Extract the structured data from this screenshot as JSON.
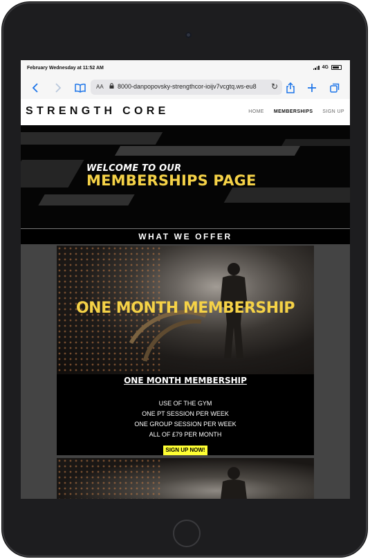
{
  "status_bar": {
    "time": "February Wednesday at 11:52 AM",
    "network": "4G"
  },
  "browser": {
    "aa_label": "AA",
    "url": "8000-danpopovsky-strengthcor-ioijv7vcgtq.ws-eu8"
  },
  "site": {
    "logo": "STRENGTH CORE",
    "nav": [
      {
        "label": "HOME"
      },
      {
        "label": "MEMBERSHIPS"
      },
      {
        "label": "SIGN UP"
      }
    ]
  },
  "hero": {
    "line1": "WELCOME TO OUR",
    "line2": "MEMBERSHIPS PAGE"
  },
  "section_title": "WHAT WE OFFER",
  "membership_card": {
    "image_title": "ONE MONTH MEMBERSHIP",
    "title": "ONE MONTH MEMBERSHIP",
    "features": [
      "USE OF THE GYM",
      "ONE PT SESSION PER WEEK",
      "ONE GROUP SESSION PER WEEK",
      "ALL OF £79 PER MONTH"
    ],
    "cta": "SIGN UP NOW!"
  },
  "colors": {
    "accent_yellow": "#f5d247",
    "button_yellow": "#ffff33",
    "link_blue": "#1a73e8"
  },
  "icons": [
    "back-icon",
    "forward-icon",
    "bookmarks-icon",
    "lock-icon",
    "reload-icon",
    "share-icon",
    "new-tab-icon",
    "tabs-icon"
  ]
}
